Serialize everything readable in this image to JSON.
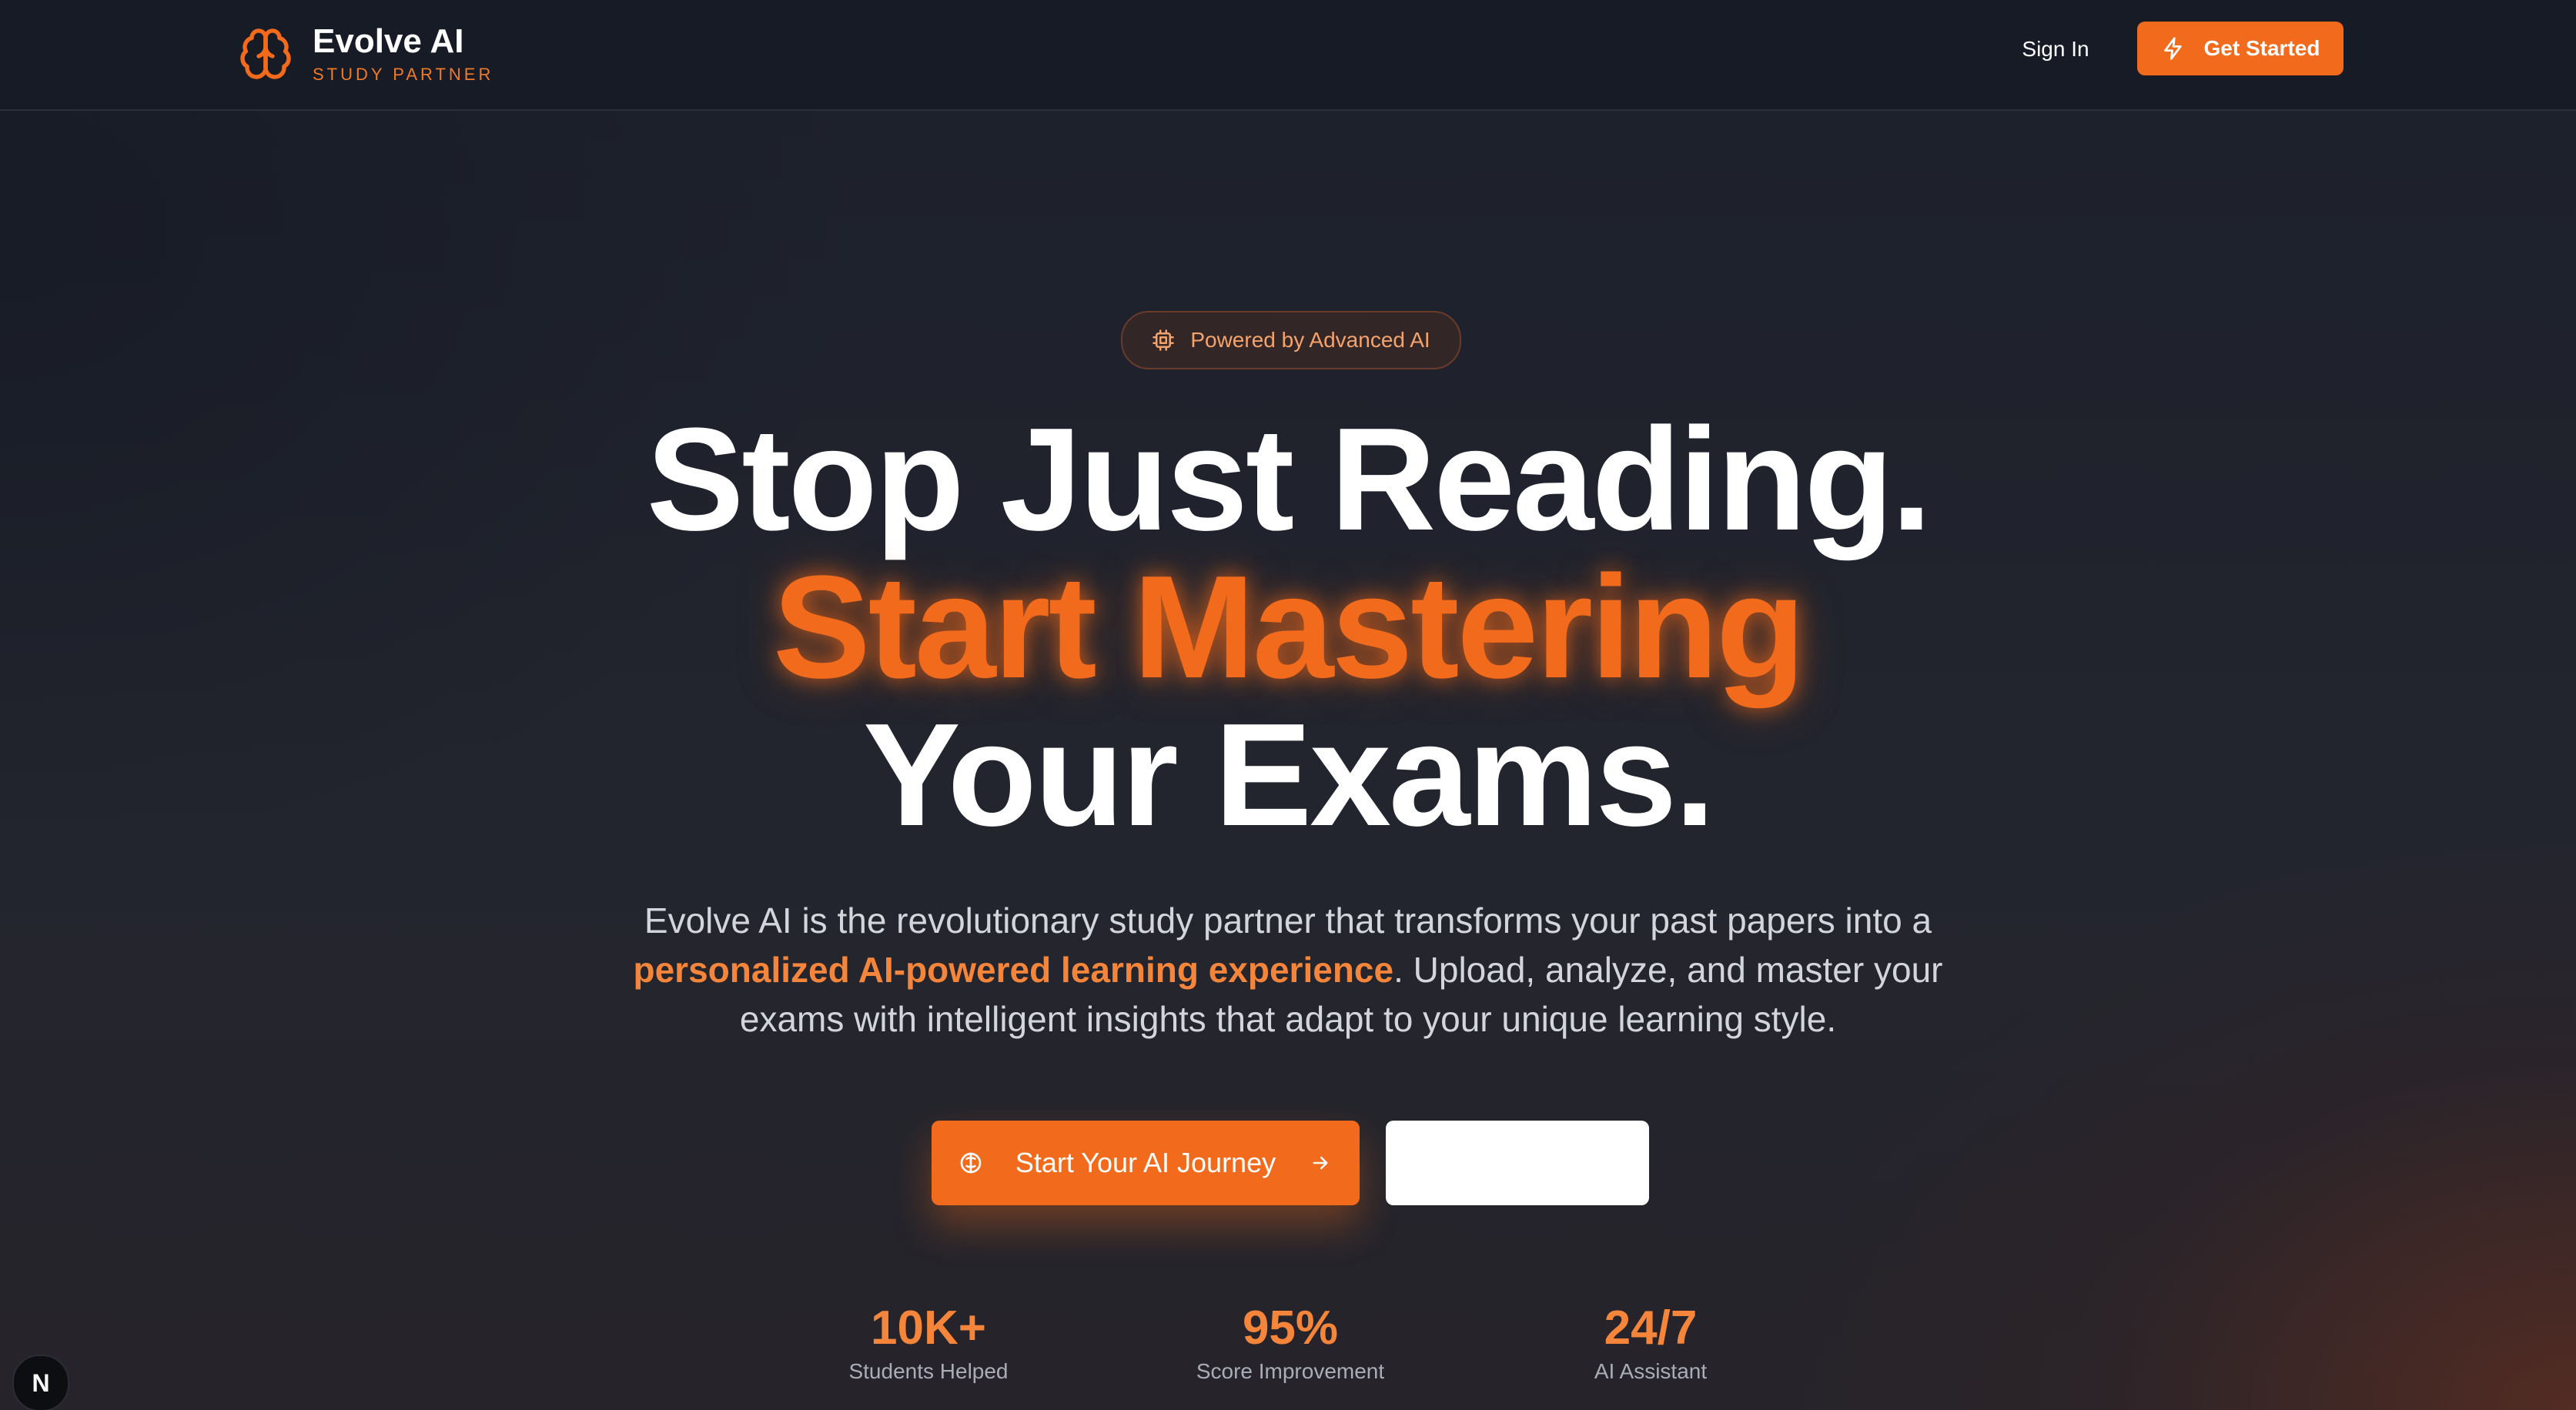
{
  "nav": {
    "brand_name": "Evolve AI",
    "brand_tag": "STUDY PARTNER",
    "brand_icon": "brain-icon",
    "signin_label": "Sign In",
    "getstarted_label": "Get Started",
    "getstarted_icon": "lightning-icon"
  },
  "hero": {
    "pill_label": "Powered by Advanced AI",
    "pill_icon": "cpu-chip-icon",
    "headline_line1": "Stop Just Reading.",
    "headline_line2": "Start Mastering",
    "headline_line3": "Your Exams.",
    "sub_part1": "Evolve AI is the revolutionary study partner that transforms your past papers into a",
    "sub_highlight": "personalized AI-powered learning experience",
    "sub_part2": ". Upload, analyze, and master your exams with intelligent insights that adapt to your unique learning style.",
    "cta_label": "Start Your AI Journey",
    "cta_icon": "brain-icon",
    "cta_arrow": "arrow-right-icon",
    "secondary_button_label": ""
  },
  "stats": [
    {
      "value": "10K+",
      "label": "Students Helped"
    },
    {
      "value": "95%",
      "label": "Score Improvement"
    },
    {
      "value": "24/7",
      "label": "AI Assistant"
    }
  ],
  "dev_badge": "N",
  "colors": {
    "accent": "#f26a1b",
    "accent_text": "#f5853a",
    "nav_bg": "#171b25",
    "page_bg": "#1f222b"
  }
}
